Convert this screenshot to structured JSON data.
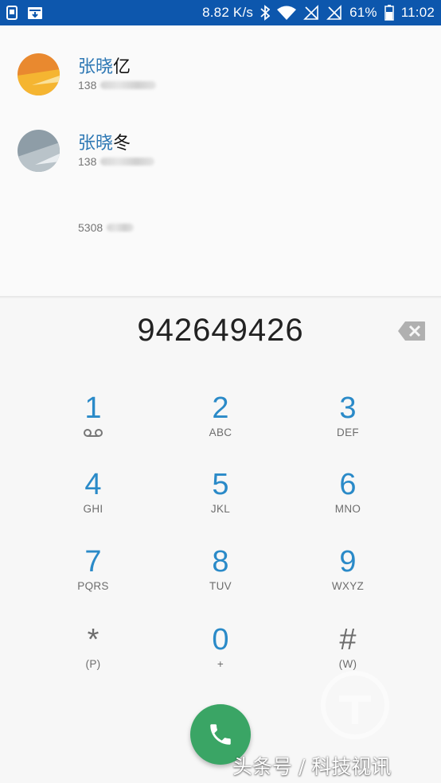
{
  "status_bar": {
    "speed": "8.82 K/s",
    "battery": "61%",
    "time": "11:02",
    "icons": [
      "sim-icon",
      "download-icon",
      "bluetooth-icon",
      "wifi-icon",
      "no-signal-icon",
      "no-signal-icon",
      "battery-icon"
    ]
  },
  "contacts": [
    {
      "name_match": "张晓",
      "name_rest": "亿",
      "number_prefix": "138",
      "avatar_colors": [
        "#e07a2e",
        "#f4b530"
      ]
    },
    {
      "name_match": "张晓",
      "name_rest": "冬",
      "number_prefix": "138",
      "avatar_colors": [
        "#8b9ba6",
        "#c3ccd2"
      ]
    },
    {
      "number_prefix": "5308"
    }
  ],
  "dialpad": {
    "digits": "942649426",
    "keys": [
      {
        "num": "1",
        "letters": ""
      },
      {
        "num": "2",
        "letters": "ABC"
      },
      {
        "num": "3",
        "letters": "DEF"
      },
      {
        "num": "4",
        "letters": "GHI"
      },
      {
        "num": "5",
        "letters": "JKL"
      },
      {
        "num": "6",
        "letters": "MNO"
      },
      {
        "num": "7",
        "letters": "PQRS"
      },
      {
        "num": "8",
        "letters": "TUV"
      },
      {
        "num": "9",
        "letters": "WXYZ"
      },
      {
        "num": "*",
        "letters": "(P)"
      },
      {
        "num": "0",
        "letters": "+"
      },
      {
        "num": "#",
        "letters": "(W)"
      }
    ]
  },
  "watermark": "头条号 / 科技视讯",
  "colors": {
    "status_bar": "#0d57ad",
    "accent": "#2a8ac8",
    "call_button": "#3aa565",
    "name_highlight": "#2e78b4"
  }
}
